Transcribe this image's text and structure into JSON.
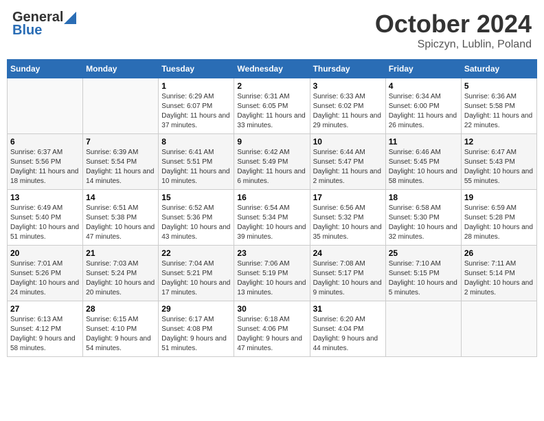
{
  "header": {
    "logo_general": "General",
    "logo_blue": "Blue",
    "month_title": "October 2024",
    "location": "Spiczyn, Lublin, Poland"
  },
  "days_of_week": [
    "Sunday",
    "Monday",
    "Tuesday",
    "Wednesday",
    "Thursday",
    "Friday",
    "Saturday"
  ],
  "weeks": [
    [
      {
        "day": "",
        "sunrise": "",
        "sunset": "",
        "daylight": ""
      },
      {
        "day": "",
        "sunrise": "",
        "sunset": "",
        "daylight": ""
      },
      {
        "day": "1",
        "sunrise": "Sunrise: 6:29 AM",
        "sunset": "Sunset: 6:07 PM",
        "daylight": "Daylight: 11 hours and 37 minutes."
      },
      {
        "day": "2",
        "sunrise": "Sunrise: 6:31 AM",
        "sunset": "Sunset: 6:05 PM",
        "daylight": "Daylight: 11 hours and 33 minutes."
      },
      {
        "day": "3",
        "sunrise": "Sunrise: 6:33 AM",
        "sunset": "Sunset: 6:02 PM",
        "daylight": "Daylight: 11 hours and 29 minutes."
      },
      {
        "day": "4",
        "sunrise": "Sunrise: 6:34 AM",
        "sunset": "Sunset: 6:00 PM",
        "daylight": "Daylight: 11 hours and 26 minutes."
      },
      {
        "day": "5",
        "sunrise": "Sunrise: 6:36 AM",
        "sunset": "Sunset: 5:58 PM",
        "daylight": "Daylight: 11 hours and 22 minutes."
      }
    ],
    [
      {
        "day": "6",
        "sunrise": "Sunrise: 6:37 AM",
        "sunset": "Sunset: 5:56 PM",
        "daylight": "Daylight: 11 hours and 18 minutes."
      },
      {
        "day": "7",
        "sunrise": "Sunrise: 6:39 AM",
        "sunset": "Sunset: 5:54 PM",
        "daylight": "Daylight: 11 hours and 14 minutes."
      },
      {
        "day": "8",
        "sunrise": "Sunrise: 6:41 AM",
        "sunset": "Sunset: 5:51 PM",
        "daylight": "Daylight: 11 hours and 10 minutes."
      },
      {
        "day": "9",
        "sunrise": "Sunrise: 6:42 AM",
        "sunset": "Sunset: 5:49 PM",
        "daylight": "Daylight: 11 hours and 6 minutes."
      },
      {
        "day": "10",
        "sunrise": "Sunrise: 6:44 AM",
        "sunset": "Sunset: 5:47 PM",
        "daylight": "Daylight: 11 hours and 2 minutes."
      },
      {
        "day": "11",
        "sunrise": "Sunrise: 6:46 AM",
        "sunset": "Sunset: 5:45 PM",
        "daylight": "Daylight: 10 hours and 58 minutes."
      },
      {
        "day": "12",
        "sunrise": "Sunrise: 6:47 AM",
        "sunset": "Sunset: 5:43 PM",
        "daylight": "Daylight: 10 hours and 55 minutes."
      }
    ],
    [
      {
        "day": "13",
        "sunrise": "Sunrise: 6:49 AM",
        "sunset": "Sunset: 5:40 PM",
        "daylight": "Daylight: 10 hours and 51 minutes."
      },
      {
        "day": "14",
        "sunrise": "Sunrise: 6:51 AM",
        "sunset": "Sunset: 5:38 PM",
        "daylight": "Daylight: 10 hours and 47 minutes."
      },
      {
        "day": "15",
        "sunrise": "Sunrise: 6:52 AM",
        "sunset": "Sunset: 5:36 PM",
        "daylight": "Daylight: 10 hours and 43 minutes."
      },
      {
        "day": "16",
        "sunrise": "Sunrise: 6:54 AM",
        "sunset": "Sunset: 5:34 PM",
        "daylight": "Daylight: 10 hours and 39 minutes."
      },
      {
        "day": "17",
        "sunrise": "Sunrise: 6:56 AM",
        "sunset": "Sunset: 5:32 PM",
        "daylight": "Daylight: 10 hours and 35 minutes."
      },
      {
        "day": "18",
        "sunrise": "Sunrise: 6:58 AM",
        "sunset": "Sunset: 5:30 PM",
        "daylight": "Daylight: 10 hours and 32 minutes."
      },
      {
        "day": "19",
        "sunrise": "Sunrise: 6:59 AM",
        "sunset": "Sunset: 5:28 PM",
        "daylight": "Daylight: 10 hours and 28 minutes."
      }
    ],
    [
      {
        "day": "20",
        "sunrise": "Sunrise: 7:01 AM",
        "sunset": "Sunset: 5:26 PM",
        "daylight": "Daylight: 10 hours and 24 minutes."
      },
      {
        "day": "21",
        "sunrise": "Sunrise: 7:03 AM",
        "sunset": "Sunset: 5:24 PM",
        "daylight": "Daylight: 10 hours and 20 minutes."
      },
      {
        "day": "22",
        "sunrise": "Sunrise: 7:04 AM",
        "sunset": "Sunset: 5:21 PM",
        "daylight": "Daylight: 10 hours and 17 minutes."
      },
      {
        "day": "23",
        "sunrise": "Sunrise: 7:06 AM",
        "sunset": "Sunset: 5:19 PM",
        "daylight": "Daylight: 10 hours and 13 minutes."
      },
      {
        "day": "24",
        "sunrise": "Sunrise: 7:08 AM",
        "sunset": "Sunset: 5:17 PM",
        "daylight": "Daylight: 10 hours and 9 minutes."
      },
      {
        "day": "25",
        "sunrise": "Sunrise: 7:10 AM",
        "sunset": "Sunset: 5:15 PM",
        "daylight": "Daylight: 10 hours and 5 minutes."
      },
      {
        "day": "26",
        "sunrise": "Sunrise: 7:11 AM",
        "sunset": "Sunset: 5:14 PM",
        "daylight": "Daylight: 10 hours and 2 minutes."
      }
    ],
    [
      {
        "day": "27",
        "sunrise": "Sunrise: 6:13 AM",
        "sunset": "Sunset: 4:12 PM",
        "daylight": "Daylight: 9 hours and 58 minutes."
      },
      {
        "day": "28",
        "sunrise": "Sunrise: 6:15 AM",
        "sunset": "Sunset: 4:10 PM",
        "daylight": "Daylight: 9 hours and 54 minutes."
      },
      {
        "day": "29",
        "sunrise": "Sunrise: 6:17 AM",
        "sunset": "Sunset: 4:08 PM",
        "daylight": "Daylight: 9 hours and 51 minutes."
      },
      {
        "day": "30",
        "sunrise": "Sunrise: 6:18 AM",
        "sunset": "Sunset: 4:06 PM",
        "daylight": "Daylight: 9 hours and 47 minutes."
      },
      {
        "day": "31",
        "sunrise": "Sunrise: 6:20 AM",
        "sunset": "Sunset: 4:04 PM",
        "daylight": "Daylight: 9 hours and 44 minutes."
      },
      {
        "day": "",
        "sunrise": "",
        "sunset": "",
        "daylight": ""
      },
      {
        "day": "",
        "sunrise": "",
        "sunset": "",
        "daylight": ""
      }
    ]
  ]
}
